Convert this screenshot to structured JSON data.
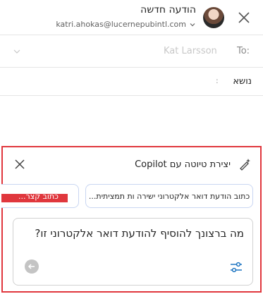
{
  "header": {
    "title": "הודעה חדשה",
    "email": "katri.ahokas@lucernepubintl.com"
  },
  "to_row": {
    "label": "To:",
    "value": "Kat Larsson"
  },
  "subject_row": {
    "label": "נושא",
    "colon": ":"
  },
  "copilot": {
    "title": "יצירת טיוטה עם Copilot",
    "chips": [
      "כתוב הודעת דואר אלקטרוני ישירה ות תמציתית...",
      "כתוב קצר..."
    ],
    "prompt_placeholder": "מה ברצונך להוסיף להודעת דואר אלקטרוני זו?"
  },
  "colors": {
    "highlight_border": "#e0373d",
    "chip_border": "#c9d6f2",
    "accent": "#0f6cbd"
  },
  "icons": [
    "close-icon",
    "avatar",
    "chevron-down-icon",
    "copilot-draft-icon",
    "settings-sliders-icon",
    "send-arrow-icon"
  ]
}
